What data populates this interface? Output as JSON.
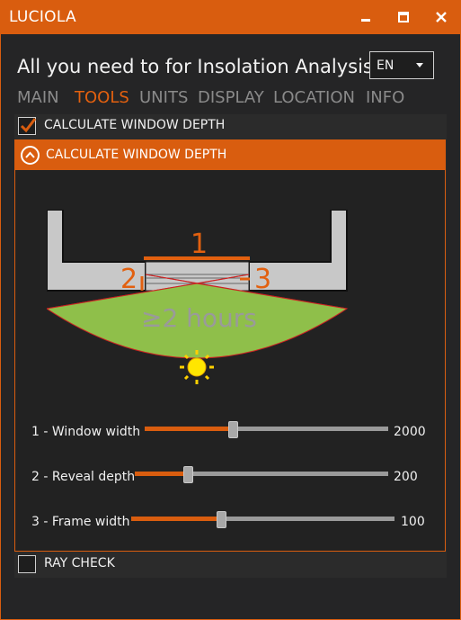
{
  "window": {
    "title": "LUCIOLA",
    "accent_color": "#d95d0f",
    "controls": {
      "minimize_icon": "minimize-icon",
      "maximize_icon": "maximize-icon",
      "close_icon": "close-icon"
    }
  },
  "header": {
    "headline": "All you need to for Insolation Analysis",
    "language": {
      "selected": "EN"
    }
  },
  "tabs": [
    {
      "label": "MAIN",
      "active": false
    },
    {
      "label": "TOOLS",
      "active": true
    },
    {
      "label": "UNITS",
      "active": false
    },
    {
      "label": "DISPLAY",
      "active": false
    },
    {
      "label": "LOCATION",
      "active": false
    },
    {
      "label": "INFO",
      "active": false
    }
  ],
  "tools": {
    "calc_checkbox": {
      "label": "CALCULATE WINDOW DEPTH",
      "checked": true
    },
    "expander": {
      "label": "CALCULATE WINDOW DEPTH",
      "expanded": true,
      "icon": "chevron-up-icon"
    },
    "diagram": {
      "label_1": "1",
      "label_2": "2",
      "label_3": "3",
      "result_text": "≥2 hours",
      "sun_icon": "sun-icon"
    },
    "sliders": [
      {
        "label": "1 - Window width",
        "value": "2000",
        "fraction": 0.36
      },
      {
        "label": "2 - Reveal depth",
        "value": "200",
        "fraction": 0.21
      },
      {
        "label": "3 - Frame width",
        "value": "100",
        "fraction": 0.34
      }
    ],
    "ray_check": {
      "label": "RAY CHECK",
      "checked": false
    }
  }
}
